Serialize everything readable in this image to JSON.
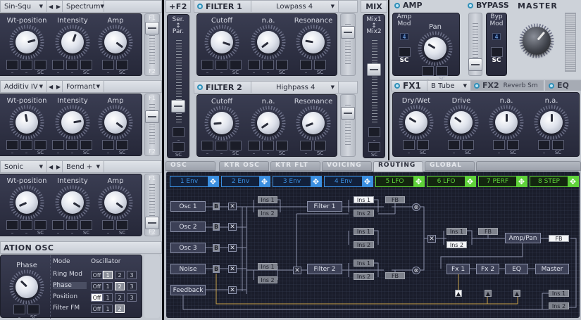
{
  "oscillators": [
    {
      "wavetable": "Sin-Squ",
      "mode": "Spectrum",
      "slider_top": "F1",
      "slider_bottom": "F2",
      "slider_value": 0.1,
      "knobs": [
        {
          "label": "Wt-position",
          "value": 0.78,
          "mods": [
            "–",
            "–",
            "SC"
          ]
        },
        {
          "label": "Intensity",
          "value": 0.57,
          "mods": [
            "–",
            "–",
            "SC"
          ]
        },
        {
          "label": "Amp",
          "value": 0.97,
          "mods": [
            "–",
            "SC"
          ]
        }
      ]
    },
    {
      "wavetable": "Additiv IV",
      "mode": "Formant",
      "slider_top": "F1",
      "slider_bottom": "F2",
      "slider_value": 0.3,
      "knobs": [
        {
          "label": "Wt-position",
          "value": 0.46,
          "mods": [
            "–",
            "–",
            "SC"
          ]
        },
        {
          "label": "Intensity",
          "value": 0.8,
          "mods": [
            "–",
            "–",
            "SC"
          ]
        },
        {
          "label": "Amp",
          "value": 0.97,
          "mods": [
            "–",
            "SC"
          ]
        }
      ]
    },
    {
      "wavetable": "Sonic",
      "mode": "Bend +",
      "slider_top": "F1",
      "slider_bottom": "F2",
      "slider_value": 0.9,
      "knobs": [
        {
          "label": "Wt-position",
          "value": 0.08,
          "mods": [
            "–",
            "–",
            "SC"
          ]
        },
        {
          "label": "Intensity",
          "value": 0.95,
          "mods": [
            "–",
            "–",
            "SC"
          ]
        },
        {
          "label": "Amp",
          "value": 0.97,
          "mods": [
            "–",
            "SC"
          ]
        }
      ]
    }
  ],
  "osc_nav": {
    "prev": "◀",
    "next": "▶"
  },
  "modulation_osc": {
    "title": "ATION OSC",
    "knob": {
      "label": "Phase",
      "value": 0.33,
      "mods": [
        "–",
        "SC"
      ]
    },
    "col_mode": "Mode",
    "col_osc": "Oscillator",
    "rows": [
      {
        "label": "Ring Mod",
        "options": [
          "Off",
          "1",
          "2",
          "3"
        ],
        "selected": "1"
      },
      {
        "label": "Phase",
        "options": [
          "Off",
          "1",
          "2",
          "3"
        ],
        "selected": "2"
      },
      {
        "label": "Position",
        "options": [
          "Off",
          "1",
          "2",
          "3"
        ],
        "selected": "Off"
      },
      {
        "label": "Filter FM",
        "options": [
          "Off",
          "1",
          "2"
        ],
        "selected": "2"
      }
    ]
  },
  "f2": {
    "title": "+F2",
    "top": "Ser.",
    "arrow": "↕",
    "bottom": "Par.",
    "slider_value": 0.78,
    "mods": [
      "–",
      "SC"
    ]
  },
  "filters": [
    {
      "title": "FILTER 1",
      "type": "Lowpass 4",
      "slider_value": 0.2,
      "knobs": [
        {
          "label": "Cutoff",
          "value": 0.9,
          "mods": [
            "–",
            "–",
            "SC"
          ]
        },
        {
          "label": "n.a.",
          "value": 0.03,
          "mods": [
            "–",
            "–",
            "SC"
          ]
        },
        {
          "label": "Resonance",
          "value": 0.2,
          "mods": [
            "–",
            "SC"
          ]
        }
      ]
    },
    {
      "title": "FILTER 2",
      "type": "Highpass 4",
      "slider_value": 0.2,
      "knobs": [
        {
          "label": "Cutoff",
          "value": 0.15,
          "mods": [
            "–",
            "–",
            "SC"
          ]
        },
        {
          "label": "n.a.",
          "value": 0.04,
          "mods": [
            "–",
            "–",
            "SC"
          ]
        },
        {
          "label": "Resonance",
          "value": 0.09,
          "mods": [
            "–",
            "SC"
          ]
        }
      ]
    }
  ],
  "mix": {
    "title": "MIX",
    "top": "Mix1",
    "arrow": "↕",
    "bottom": "Mix2",
    "slider_value": 0.35,
    "mods": [
      "–",
      "SC"
    ]
  },
  "amp": {
    "title": "AMP",
    "mod_label_1": "Amp",
    "mod_label_2": "Mod",
    "mod_value": "4",
    "sc": "SC",
    "knob": {
      "label": "Pan",
      "value": 0.28,
      "mods": [
        "–",
        "SC"
      ]
    }
  },
  "bypass": {
    "title": "BYPASS",
    "mod_label_1": "Byp",
    "mod_label_2": "Mod",
    "mod_value": "4",
    "sc": "SC",
    "slider_value": 0.95
  },
  "master": {
    "title": "MASTER",
    "value": 0.65
  },
  "fx": {
    "tabs": [
      {
        "label": "FX1",
        "preset": "B Tube"
      },
      {
        "label": "FX2",
        "preset": "Reverb Sm"
      },
      {
        "label": "EQ"
      }
    ],
    "knobs": [
      {
        "label": "Dry/Wet",
        "value": 0.28,
        "mods": [
          "–",
          "SC"
        ]
      },
      {
        "label": "Drive",
        "value": 0.3,
        "mods": [
          "–",
          "SC"
        ]
      },
      {
        "label": "n.a.",
        "value": 0.5,
        "mods": [
          "–",
          "SC"
        ]
      },
      {
        "label": "n.a.",
        "value": 0.5,
        "mods": [
          "–",
          "SC"
        ]
      }
    ]
  },
  "tabs": [
    "OSC",
    "KTR OSC",
    "KTR FLT",
    "VOICING",
    "ROUTING",
    "GLOBAL"
  ],
  "active_tab": "ROUTING",
  "mod_sources": [
    {
      "label": "1 Env",
      "kind": "env"
    },
    {
      "label": "2 Env",
      "kind": "env"
    },
    {
      "label": "3 Env",
      "kind": "env"
    },
    {
      "label": "4 Env",
      "kind": "env"
    },
    {
      "label": "5 LFO",
      "kind": "lfo"
    },
    {
      "label": "6 LFO",
      "kind": "lfo"
    },
    {
      "label": "7 PERF",
      "kind": "lfo"
    },
    {
      "label": "8 STEP",
      "kind": "lfo"
    }
  ],
  "colors": {
    "env": "#3b8fe0",
    "lfo": "#5fd23a"
  },
  "routing": {
    "osc1": "Osc 1",
    "osc2": "Osc 2",
    "osc3": "Osc 3",
    "noise": "Noise",
    "feedback": "Feedback",
    "b": "B",
    "x": "✕",
    "circle": "⊗",
    "ins1": "Ins 1",
    "ins2": "Ins 2",
    "fb": "FB",
    "filter1": "Filter 1",
    "filter2": "Filter 2",
    "amp_pan": "Amp/Pan",
    "fx1": "Fx 1",
    "fx2": "Fx 2",
    "eq": "EQ",
    "master": "Master",
    "tri": "▲"
  }
}
